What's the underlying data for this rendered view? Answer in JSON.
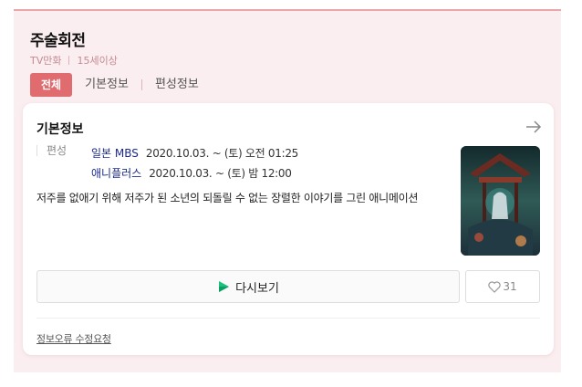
{
  "program": {
    "title": "주술회전",
    "category": "TV만화",
    "rating": "15세이상"
  },
  "tabs": [
    {
      "label": "전체",
      "active": true
    },
    {
      "label": "기본정보",
      "active": false
    },
    {
      "label": "편성정보",
      "active": false
    }
  ],
  "card": {
    "title": "기본정보",
    "schedule_label": "편성",
    "schedule": [
      {
        "channel": "일본 MBS",
        "time": "2020.10.03. ~ (토) 오전 01:25"
      },
      {
        "channel": "애니플러스",
        "time": "2020.10.03. ~ (토) 밤 12:00"
      }
    ],
    "description": "저주를 없애기 위해 저주가 된 소년의 되돌릴 수 없는 장렬한 이야기를 그린 애니메이션",
    "replay_label": "다시보기",
    "like_count": "31",
    "report_label": "정보오류 수정요청"
  },
  "icons": {
    "arrow": "arrow-right-icon",
    "play": "play-icon",
    "heart": "heart-icon"
  },
  "colors": {
    "accent": "#e06c70",
    "panel_bg": "#fbeef0",
    "channel_text": "#1a2a8c",
    "play_green": "#19c37d"
  }
}
